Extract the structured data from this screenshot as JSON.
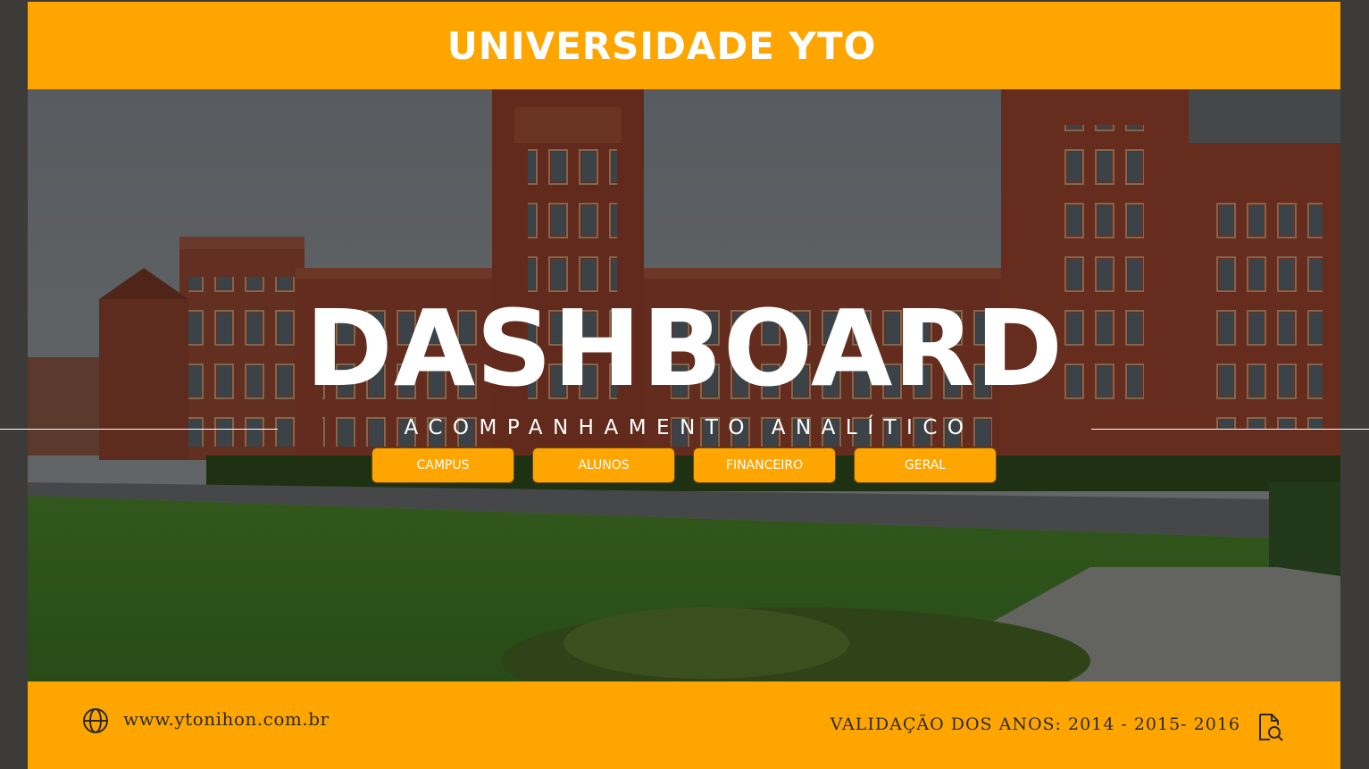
{
  "header": {
    "title": "UNIVERSIDADE YTO"
  },
  "hero": {
    "title": "DASHBOARD",
    "subtitle": "ACOMPANHAMENTO ANALÍTICO",
    "background_image": "university-building-photo"
  },
  "nav": {
    "buttons": [
      {
        "label": "CAMPUS"
      },
      {
        "label": "ALUNOS"
      },
      {
        "label": "FINANCEIRO"
      },
      {
        "label": "GERAL"
      }
    ]
  },
  "footer": {
    "website": "www.ytonihon.com.br",
    "website_icon": "globe-icon",
    "validation": "VALIDAÇÃO DOS ANOS: 2014 - 2015- 2016",
    "validation_icon": "search-doc-icon"
  },
  "colors": {
    "accent": "#ffa500",
    "side_background": "#3c3b3a",
    "text_light": "#ffffff",
    "text_dark": "#2b2b2b"
  }
}
